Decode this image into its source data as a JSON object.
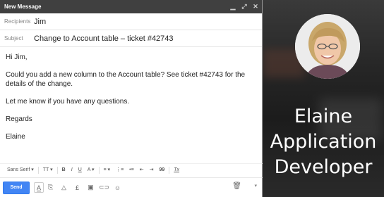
{
  "window": {
    "title": "New Message",
    "controls": [
      "minimize-icon",
      "expand-icon",
      "close-icon"
    ]
  },
  "recipients": {
    "label": "Recipients",
    "value": "Jim"
  },
  "subject": {
    "label": "Subject",
    "value": "Change to Account table – ticket #42743"
  },
  "body": {
    "greeting": "Hi Jim,",
    "para1": "Could you add a new column to the Account table? See ticket #42743 for the details of the change.",
    "para2": "Let me know if you have any questions.",
    "closing": "Regards",
    "signature": "Elaine"
  },
  "format_toolbar": {
    "font": "Sans Serif",
    "size": "TT",
    "bold": "B",
    "italic": "I",
    "underline": "U",
    "text_color": "A",
    "align": "≡",
    "numbered_list": "⋮≡",
    "bulleted_list": "•≡",
    "indent_less": "⇤",
    "indent_more": "⇥",
    "quote": "99",
    "clear": "Tx"
  },
  "send_toolbar": {
    "send_label": "Send",
    "icons": [
      "formatting-icon",
      "attach-icon",
      "drive-icon",
      "money-icon",
      "photo-icon",
      "link-icon",
      "emoji-icon"
    ],
    "trash": "trash-icon",
    "more": "more-options-icon"
  },
  "profile": {
    "name": "Elaine",
    "role_line1": "Application",
    "role_line2": "Developer"
  },
  "colors": {
    "titlebar": "#404040",
    "send_button": "#4285f4",
    "side_bg": "#262626"
  }
}
